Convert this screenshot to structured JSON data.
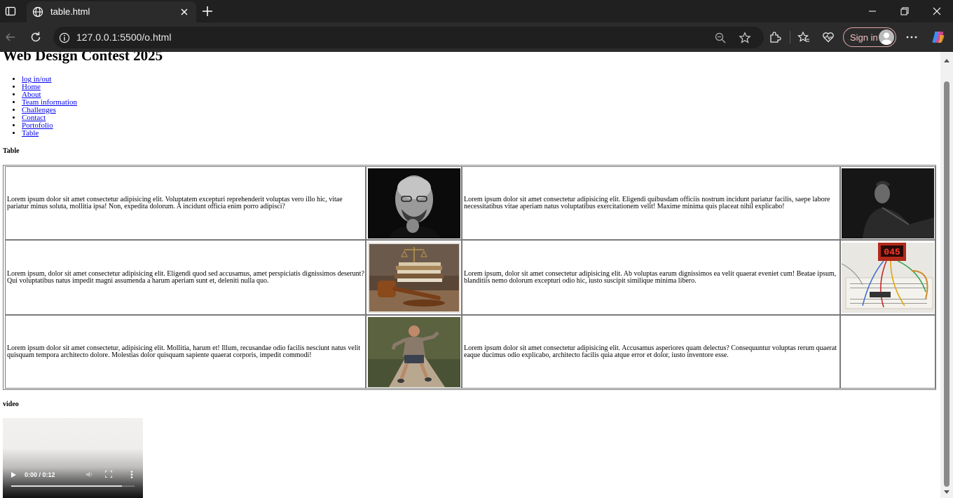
{
  "browser": {
    "tab_title": "table.html",
    "url": "127.0.0.1:5500/o.html",
    "sign_in_label": "Sign in"
  },
  "page": {
    "heading": "Web Design Contest 2025",
    "nav": [
      "log in/out",
      "Home",
      "About",
      "Team information",
      "Challenges",
      "Contact",
      "Portofolio",
      "Table"
    ],
    "table_heading": "Table",
    "video_heading": "video",
    "rows": [
      {
        "text1": "Lorem ipsum dolor sit amet consectetur adipisicing elit. Voluptatem excepturi reprehenderit voluptas vero illo hic, vitae pariatur minus soluta, mollitia ipsa! Non, expedita dolorum. A incidunt officia enim porro adipisci?",
        "img1": "portrait-bw-man-glasses",
        "text2": "Lorem ipsum dolor sit amet consectetur adipisicing elit. Eligendi quibusdam officiis nostrum incidunt pariatur facilis, saepe labore necessitatibus vitae aperiam natus voluptatibus exercitationem velit! Maxime minima quis placeat nihil explicabo!",
        "img2": "dark-profile-man"
      },
      {
        "text1": "Lorem ipsum, dolor sit amet consectetur adipisicing elit. Eligendi quod sed accusamus, amet perspiciatis dignissimos deserunt? Qui voluptatibus natus impedit magni assumenda a harum aperiam sunt et, deleniti nulla quo.",
        "img1": "gavel-books-scales",
        "text2": "Lorem ipsum, dolor sit amet consectetur adipisicing elit. Ab voluptas earum dignissimos ea velit quaerat eveniet cum! Beatae ipsum, blanditiis nemo dolorum excepturi odio hic, iusto suscipit similique minima libero.",
        "img2": "breadboard-circuit",
        "img2_display": "045"
      },
      {
        "text1": "Lorem ipsum dolor sit amet consectetur, adipisicing elit. Mollitia, harum et! Illum, recusandae odio facilis nesciunt natus velit quisquam tempora architecto dolore. Molestias dolor quisquam sapiente quaerat corporis, impedit commodi!",
        "img1": "runner",
        "text2": "Lorem ipsum dolor sit amet consectetur adipisicing elit. Accusamus asperiores quam delectus? Consequuntur voluptas rerum quaerat eaque ducimus odio explicabo, architecto facilis quia atque error et dolor, iusto inventore esse.",
        "img2": ""
      }
    ],
    "video": {
      "time": "0:00 / 0:12",
      "progress": 0.9
    }
  }
}
